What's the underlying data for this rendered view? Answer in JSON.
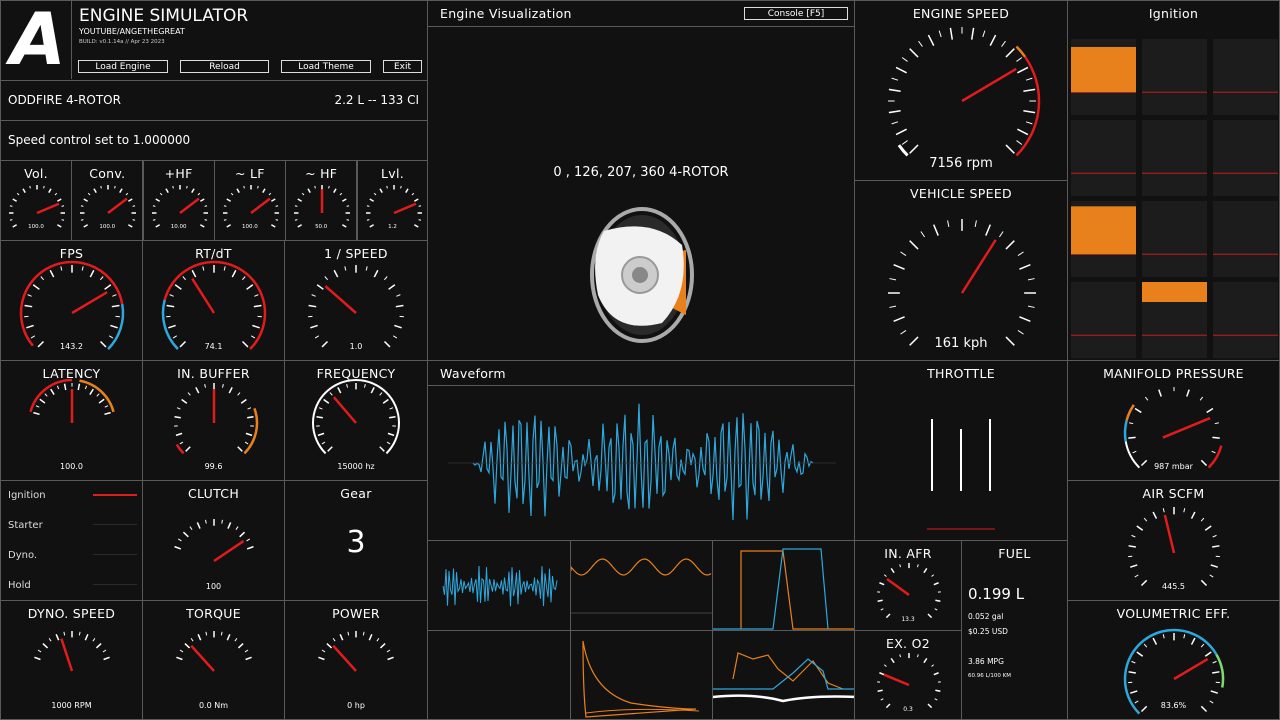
{
  "header": {
    "logo": "A",
    "title": "ENGINE SIMULATOR",
    "subtitle": "YOUTUBE/ANGETHEGREAT",
    "build": "BUILD: v0.1.14a // Apr 23 2023",
    "buttons": [
      "Load Engine",
      "Reload",
      "Load Theme",
      "Exit"
    ]
  },
  "engine_info": {
    "name": "ODDFIRE 4-ROTOR",
    "displacement": "2.2 L -- 133 CI"
  },
  "status": "Speed control set to 1.000000",
  "audio_gauges": [
    {
      "label": "Vol.",
      "value": "100.0"
    },
    {
      "label": "Conv.",
      "value": "100.0"
    },
    {
      "label": "+HF",
      "value": "10.00"
    },
    {
      "label": "~ LF",
      "value": "100.0"
    },
    {
      "label": "~ HF",
      "value": "50.0"
    },
    {
      "label": "Lvl.",
      "value": "1.2"
    }
  ],
  "perf_gauges": [
    {
      "label": "FPS",
      "value": "143.2"
    },
    {
      "label": "RT/dT",
      "value": "74.1"
    },
    {
      "label": "1 / SPEED",
      "value": "1.0"
    }
  ],
  "audio_gauges2": [
    {
      "label": "LATENCY",
      "value": "100.0"
    },
    {
      "label": "IN. BUFFER",
      "value": "99.6"
    },
    {
      "label": "FREQUENCY",
      "value": "15000 hz"
    }
  ],
  "switches": {
    "items": [
      "Ignition",
      "Starter",
      "Dyno.",
      "Hold"
    ],
    "colors": {
      "on": "#e01c1c",
      "off": "#2a2a2a"
    }
  },
  "clutch": {
    "label": "CLUTCH",
    "value": "100"
  },
  "gear": {
    "label": "Gear",
    "value": "3"
  },
  "dyno_gauges": [
    {
      "label": "DYNO. SPEED",
      "value": "1000 RPM"
    },
    {
      "label": "TORQUE",
      "value": "0.0 Nm"
    },
    {
      "label": "POWER",
      "value": "0 hp"
    }
  ],
  "visualization": {
    "title": "Engine Visualization",
    "console_button": "Console [F5]",
    "firing_order": "0 , 126, 207, 360 4-ROTOR"
  },
  "waveform": {
    "title": "Waveform"
  },
  "engine_speed": {
    "label": "ENGINE SPEED",
    "value": "7156 rpm",
    "fraction": 0.72
  },
  "vehicle_speed": {
    "label": "VEHICLE SPEED",
    "value": "161 kph",
    "fraction": 0.62
  },
  "throttle": {
    "label": "THROTTLE"
  },
  "ignition": {
    "title": "Ignition",
    "bar_fraction": [
      0.85,
      0,
      0,
      0,
      0,
      0,
      0.9,
      0,
      0,
      0,
      0.5,
      0
    ]
  },
  "manifold": {
    "label": "MANIFOLD PRESSURE",
    "value": "987 mbar"
  },
  "air": {
    "label": "AIR SCFM",
    "value": "445.5"
  },
  "ve": {
    "label": "VOLUMETRIC EFF.",
    "value": "83.6%"
  },
  "afr": {
    "label": "IN. AFR",
    "value": "13.3"
  },
  "o2": {
    "label": "EX. O2",
    "value": "0.3"
  },
  "fuel": {
    "label": "FUEL",
    "liters": "0.199 L",
    "gal": "0.052 gal",
    "usd": "$0.25 USD",
    "mpg": "3.86 MPG",
    "lkm": "60.96 L/100 KM"
  },
  "colors": {
    "accent": "#e8811c",
    "needle": "#e01c1c",
    "blue": "#2ea8dc",
    "green": "#7ddc6e"
  }
}
